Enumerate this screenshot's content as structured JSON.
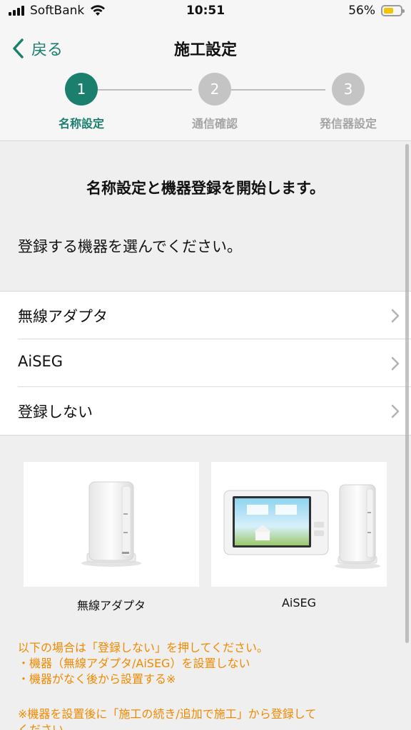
{
  "status_bar": {
    "carrier": "SoftBank",
    "time": "10:51",
    "battery_percent": "56%",
    "battery_level": 0.56,
    "battery_color": "#f5c400"
  },
  "nav": {
    "back_label": "戻る",
    "title": "施工設定"
  },
  "steps": [
    {
      "number": "1",
      "label": "名称設定",
      "active": true
    },
    {
      "number": "2",
      "label": "通信確認",
      "active": false
    },
    {
      "number": "3",
      "label": "発信器設定",
      "active": false
    }
  ],
  "intro": {
    "title": "名称設定と機器登録を開始します。",
    "subtitle": "登録する機器を選んでください。"
  },
  "options": [
    {
      "label": "無線アダプタ"
    },
    {
      "label": "AiSEG"
    },
    {
      "label": "登録しない"
    }
  ],
  "devices": [
    {
      "caption": "無線アダプタ"
    },
    {
      "caption": "AiSEG"
    }
  ],
  "notes": {
    "line1": "以下の場合は「登録しない」を押してください。",
    "line2": "・機器（無線アダプタ/AiSEG）を設置しない",
    "line3": "・機器がなく後から設置する※",
    "line4": "※機器を設置後に「施工の続き/追加で施工」から登録して",
    "line5": "ください。"
  },
  "colors": {
    "accent": "#1b7f6e",
    "note": "#f08a00",
    "inactive_step": "#c4c4c4"
  },
  "icons": [
    "signal-icon",
    "wifi-icon",
    "battery-icon",
    "chevron-left-icon",
    "chevron-right-icon"
  ]
}
